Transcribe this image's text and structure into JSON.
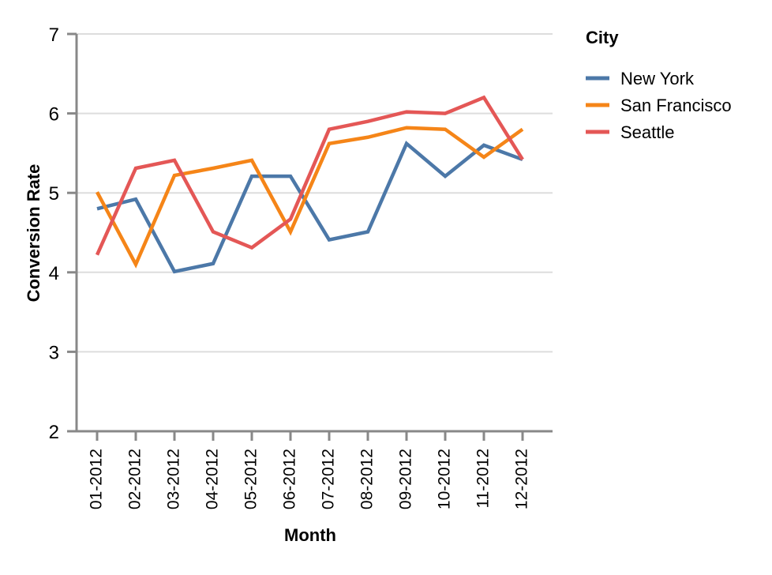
{
  "chart_data": {
    "type": "line",
    "title": "",
    "xlabel": "Month",
    "ylabel": "Conversion Rate",
    "categories": [
      "01-2012",
      "02-2012",
      "03-2012",
      "04-2012",
      "05-2012",
      "06-2012",
      "07-2012",
      "08-2012",
      "09-2012",
      "10-2012",
      "11-2012",
      "12-2012"
    ],
    "series": [
      {
        "name": "New York",
        "color": "#4c78a8",
        "values": [
          4.8,
          4.92,
          4.01,
          4.11,
          5.21,
          5.21,
          4.41,
          4.51,
          5.62,
          5.21,
          5.6,
          5.42
        ]
      },
      {
        "name": "San Francisco",
        "color": "#f58518",
        "values": [
          5.01,
          4.1,
          5.22,
          5.31,
          5.41,
          4.51,
          5.62,
          5.7,
          5.82,
          5.8,
          5.45,
          5.8
        ]
      },
      {
        "name": "Seattle",
        "color": "#e45756",
        "values": [
          4.22,
          5.31,
          5.41,
          4.51,
          4.31,
          4.67,
          5.8,
          5.9,
          6.02,
          6.0,
          6.2,
          5.42
        ]
      }
    ],
    "ylim": [
      2,
      7
    ],
    "yticks": [
      2,
      3,
      4,
      5,
      6,
      7
    ],
    "grid": true,
    "legend_position": "right",
    "legend_title": "City",
    "xtick_rotation": -90
  },
  "legend": {
    "title": "City",
    "entries": [
      {
        "label": "New York",
        "color": "#4c78a8"
      },
      {
        "label": "San Francisco",
        "color": "#f58518"
      },
      {
        "label": "Seattle",
        "color": "#e45756"
      }
    ]
  },
  "axes": {
    "y_title": "Conversion Rate",
    "x_title": "Month",
    "y_tick_labels": [
      "7",
      "6",
      "5",
      "4",
      "3",
      "2"
    ],
    "x_tick_labels": [
      "01-2012",
      "02-2012",
      "03-2012",
      "04-2012",
      "05-2012",
      "06-2012",
      "07-2012",
      "08-2012",
      "09-2012",
      "10-2012",
      "11-2012",
      "12-2012"
    ]
  },
  "colors": {
    "axis": "#888888",
    "grid": "#dddddd",
    "text": "#000000",
    "background": "#ffffff"
  }
}
